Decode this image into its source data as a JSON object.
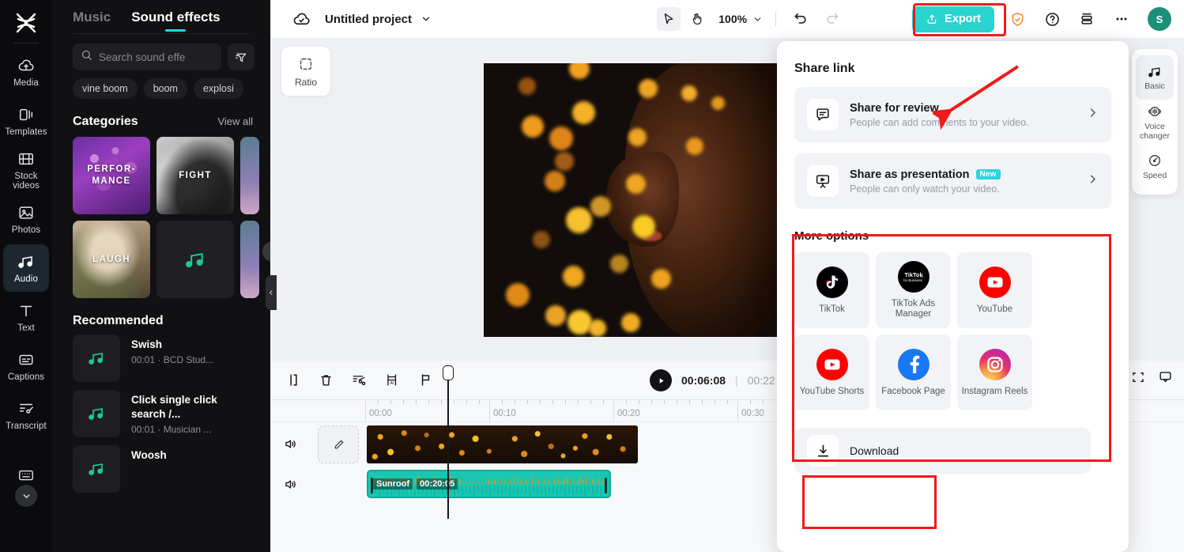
{
  "app": {
    "name": "CapCut",
    "accent": "#2ad4cf",
    "annotation_color": "#f01a1a"
  },
  "left_rail": {
    "items": [
      {
        "label": "Media",
        "icon": "cloud-upload-icon",
        "active": false
      },
      {
        "label": "Templates",
        "icon": "templates-icon",
        "active": false
      },
      {
        "label": "Stock videos",
        "icon": "film-icon",
        "active": false
      },
      {
        "label": "Photos",
        "icon": "photo-icon",
        "active": false
      },
      {
        "label": "Audio",
        "icon": "music-note-icon",
        "active": true
      },
      {
        "label": "Text",
        "icon": "text-icon",
        "active": false
      },
      {
        "label": "Captions",
        "icon": "captions-icon",
        "active": false
      },
      {
        "label": "Transcript",
        "icon": "transcript-icon",
        "active": false
      },
      {
        "label": "",
        "icon": "keyboard-icon",
        "active": false
      }
    ]
  },
  "audio_panel": {
    "tabs": [
      {
        "label": "Music",
        "active": false
      },
      {
        "label": "Sound effects",
        "active": true
      }
    ],
    "search": {
      "placeholder": "Search sound effe",
      "value": ""
    },
    "chips": [
      "vine boom",
      "boom",
      "explosi"
    ],
    "categories_header": "Categories",
    "view_all": "View all",
    "categories": [
      {
        "label": "PERFOR-\nMANCE",
        "style": "performance"
      },
      {
        "label": "FIGHT",
        "style": "fight"
      },
      {
        "label": "LAUGH",
        "style": "laugh"
      },
      {
        "label": "",
        "style": "music"
      }
    ],
    "recommended_header": "Recommended",
    "recommended": [
      {
        "name": "Swish",
        "meta": "00:01 · BCD Stud..."
      },
      {
        "name": "Click single click search /...",
        "meta": "00:01 · Musician ..."
      },
      {
        "name": "Woosh",
        "meta": ""
      }
    ]
  },
  "topbar": {
    "cloud_icon": "cloud-check-icon",
    "project_title": "Untitled project",
    "caret_icon": "chevron-down-icon",
    "tools": [
      {
        "name": "select-tool",
        "icon": "cursor-icon",
        "selected": true
      },
      {
        "name": "hand-tool",
        "icon": "hand-icon",
        "selected": false
      }
    ],
    "zoom_level": "100%",
    "undo_label": "undo",
    "redo_label": "redo",
    "export_label": "Export",
    "shield_icon": "shield-check-icon",
    "help_icon": "question-circle-icon",
    "layout_icon": "layout-icon",
    "more_icon": "more-horizontal-icon",
    "avatar_initial": "S"
  },
  "preview": {
    "ratio_label": "Ratio",
    "ratio_icon": "crop-dashed-icon"
  },
  "timeline": {
    "tools": [
      {
        "name": "split-icon"
      },
      {
        "name": "delete-icon"
      },
      {
        "name": "auto-cut-icon"
      },
      {
        "name": "ai-frame-icon"
      },
      {
        "name": "marker-flag-icon"
      }
    ],
    "current_time": "00:06:08",
    "separator": "|",
    "total_time": "00:22",
    "ruler_labels": [
      "00:00",
      "00:10",
      "00:20",
      "00:30"
    ],
    "tracks": [
      {
        "type": "video",
        "speaker_icon": "speaker-icon",
        "edit_icon": "pencil-icon"
      },
      {
        "type": "audio",
        "speaker_icon": "speaker-icon",
        "clip_name": "Sunroof",
        "clip_duration": "00:20:05"
      }
    ],
    "right_icons": [
      "brackets-icon",
      "monitor-down-icon"
    ]
  },
  "right_dock": {
    "items": [
      {
        "label": "Basic",
        "icon": "music-note-icon",
        "active": true
      },
      {
        "label": "Voice changer",
        "icon": "voice-changer-icon",
        "active": false
      },
      {
        "label": "Speed",
        "icon": "speedometer-icon",
        "active": false
      }
    ]
  },
  "share_popover": {
    "title": "Share link",
    "rows": [
      {
        "title": "Share for review",
        "subtitle": "People can add comments to your video.",
        "icon": "comment-box-icon",
        "badge": "",
        "chevron": "chevron-right-icon"
      },
      {
        "title": "Share as presentation",
        "subtitle": "People can only watch your video.",
        "icon": "presentation-icon",
        "badge": "New",
        "chevron": "chevron-right-icon"
      }
    ],
    "more_options_title": "More options",
    "tiles": [
      {
        "label": "TikTok",
        "icon": "tiktok-icon"
      },
      {
        "label": "TikTok Ads Manager",
        "icon": "tiktok-ads-icon"
      },
      {
        "label": "YouTube",
        "icon": "youtube-icon"
      },
      {
        "label": "YouTube Shorts",
        "icon": "youtube-shorts-icon"
      },
      {
        "label": "Facebook Page",
        "icon": "facebook-icon"
      },
      {
        "label": "Instagram Reels",
        "icon": "instagram-icon"
      }
    ],
    "download_label": "Download",
    "download_icon": "download-icon"
  }
}
